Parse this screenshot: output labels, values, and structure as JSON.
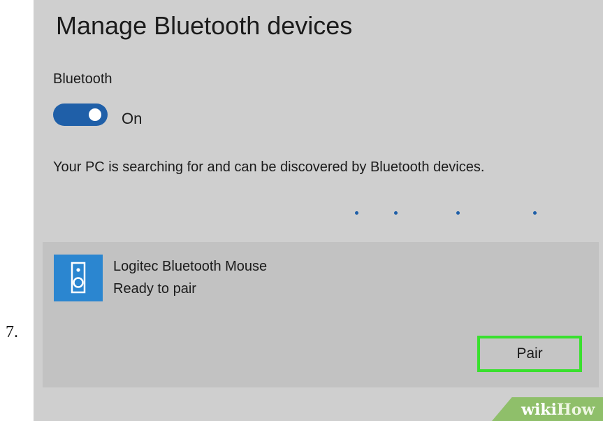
{
  "step": {
    "number": "7."
  },
  "page": {
    "title": "Manage Bluetooth devices"
  },
  "bluetooth": {
    "label": "Bluetooth",
    "toggle_on": true,
    "toggle_state": "On",
    "searching_text": "Your PC is searching for and can be discovered by Bluetooth devices."
  },
  "device": {
    "icon": "speaker-icon",
    "name": "Logitec Bluetooth Mouse",
    "status": "Ready to pair",
    "pair_label": "Pair"
  },
  "watermark": {
    "part1": "wiki",
    "part2": "How"
  },
  "colors": {
    "accent": "#1f5fa8",
    "device_icon_bg": "#2b86d0",
    "highlight": "#39e02e",
    "panel_bg": "#cfcfcf",
    "card_bg": "#c2c2c2"
  }
}
